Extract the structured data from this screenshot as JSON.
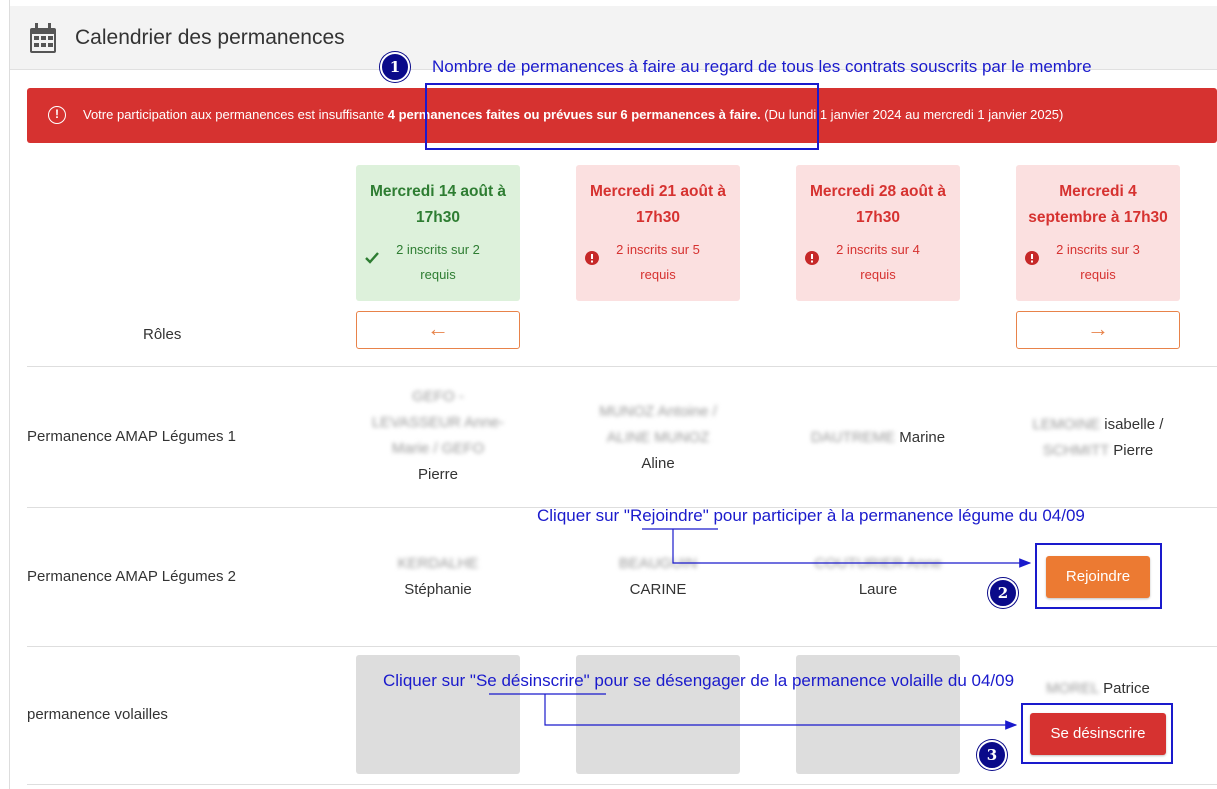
{
  "header": {
    "title": "Calendrier des permanences"
  },
  "alert": {
    "prefix": "Votre participation aux permanences est insuffisante",
    "highlight": "4 permanences faites ou prévues sur 6 permanences à faire.",
    "period": "(Du lundi 1 janvier 2024 au mercredi 1 janvier 2025)"
  },
  "roles_label": "Rôles",
  "dates": [
    {
      "label": "Mercredi 14 août à 17h30",
      "count": "2 inscrits sur 2 requis",
      "status": "ok"
    },
    {
      "label": "Mercredi 21 août à 17h30",
      "count": "2 inscrits sur 5 requis",
      "status": "ko"
    },
    {
      "label": "Mercredi 28 août à 17h30",
      "count": "2 inscrits sur 4 requis",
      "status": "ko"
    },
    {
      "label": "Mercredi 4 septembre à 17h30",
      "count": "2 inscrits sur 3 requis",
      "status": "ko"
    }
  ],
  "nav": {
    "prev": "←",
    "next": "→"
  },
  "rows": [
    {
      "label": "Permanence AMAP Légumes 1",
      "cells": [
        {
          "blurred": "GEFO - LEVASSEUR Anne-Marie / GEFO",
          "name": "Pierre"
        },
        {
          "blurred": "MUNOZ Antoine / ALINE MUNOZ",
          "name": "Aline"
        },
        {
          "blurred": "DAUTREME",
          "name": "Marine"
        },
        {
          "blurred": "LEMOINE",
          "name": "isabelle /",
          "blurred2": "SCHMITT",
          "name2": "Pierre"
        }
      ]
    },
    {
      "label": "Permanence AMAP Légumes 2",
      "cells": [
        {
          "blurred": "KERDALHE",
          "name": "Stéphanie"
        },
        {
          "blurred": "BEAUGUIN",
          "name": "CARINE"
        },
        {
          "blurred": "COUTURIER Anne",
          "name": "Laure"
        }
      ],
      "action": "Rejoindre"
    },
    {
      "label": "permanence volailles",
      "cells": [
        {
          "blurred": "MOREL",
          "name": "Patrice"
        }
      ],
      "action": "Se désinscrire"
    }
  ],
  "annotations": {
    "a1": {
      "number": "1",
      "text": "Nombre de permanences à faire au regard de tous les contrats souscrits par le membre"
    },
    "a2": {
      "number": "2",
      "text": "Cliquer sur \"Rejoindre\" pour participer à la permanence légume du 04/09"
    },
    "a3": {
      "number": "3",
      "text": "Cliquer sur \"Se désinscrire\" pour se désengager de la permanence volaille du 04/09"
    }
  },
  "colors": {
    "alert": "#d63230",
    "ok_bg": "#ddf1db",
    "ko_bg": "#fbe0e0",
    "join": "#ec7a32",
    "leave": "#d63230",
    "annotation": "#1a1acc"
  }
}
